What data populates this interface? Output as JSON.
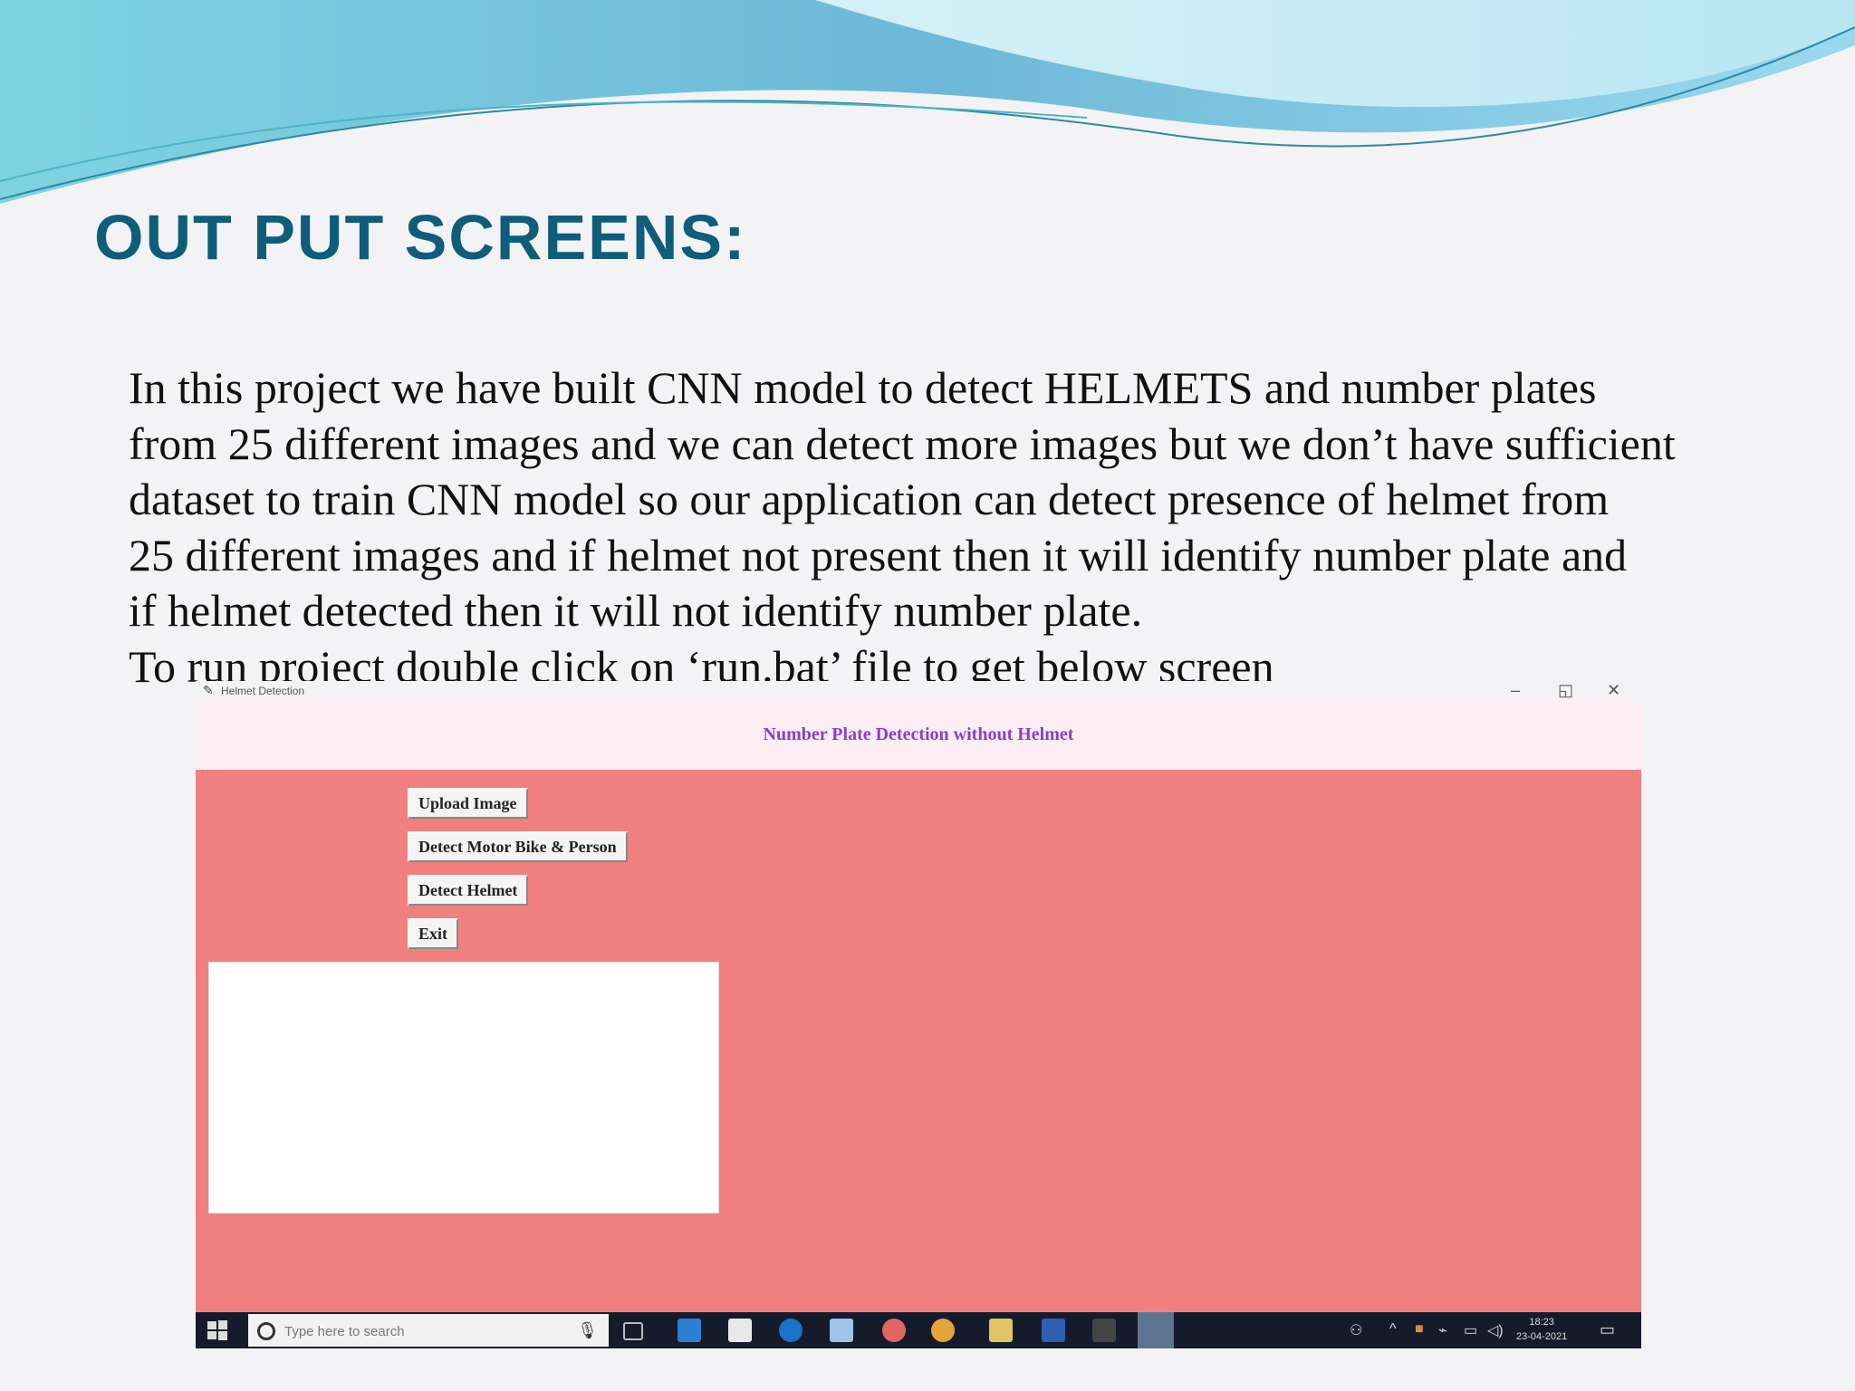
{
  "slide": {
    "title": "OUT PUT SCREENS:",
    "body_lines": [
      "In this project we have built CNN model to detect HELMETS and number plates",
      "from 25 different images and we can detect more images but we don’t have sufficient",
      "dataset to train CNN model so our application can detect presence of helmet from",
      "25 different images and if helmet not present then it will identify number plate and",
      "if helmet detected then it will not identify number plate.",
      "To run project double click on ‘run.bat’ file to get below screen"
    ]
  },
  "window": {
    "title": "Helmet Detection",
    "controls": {
      "minimize": "–",
      "maximize": "◱",
      "close": "✕"
    }
  },
  "app": {
    "header": "Number Plate Detection without Helmet",
    "buttons": {
      "upload": "Upload Image",
      "detect_bike": "Detect Motor Bike & Person",
      "detect_helmet": "Detect Helmet",
      "exit": "Exit"
    },
    "background_color": "#f08080",
    "header_color": "#8a3dd0"
  },
  "taskbar": {
    "search_placeholder": "Type here to search",
    "clock_time": "18:23",
    "clock_date": "23-04-2021",
    "apps": [
      "task-view-icon",
      "mail-icon",
      "store-icon",
      "edge-icon",
      "files-icon",
      "paint-icon",
      "chrome-icon",
      "explorer-icon",
      "word-icon",
      "terminal-icon",
      "python-icon"
    ]
  }
}
